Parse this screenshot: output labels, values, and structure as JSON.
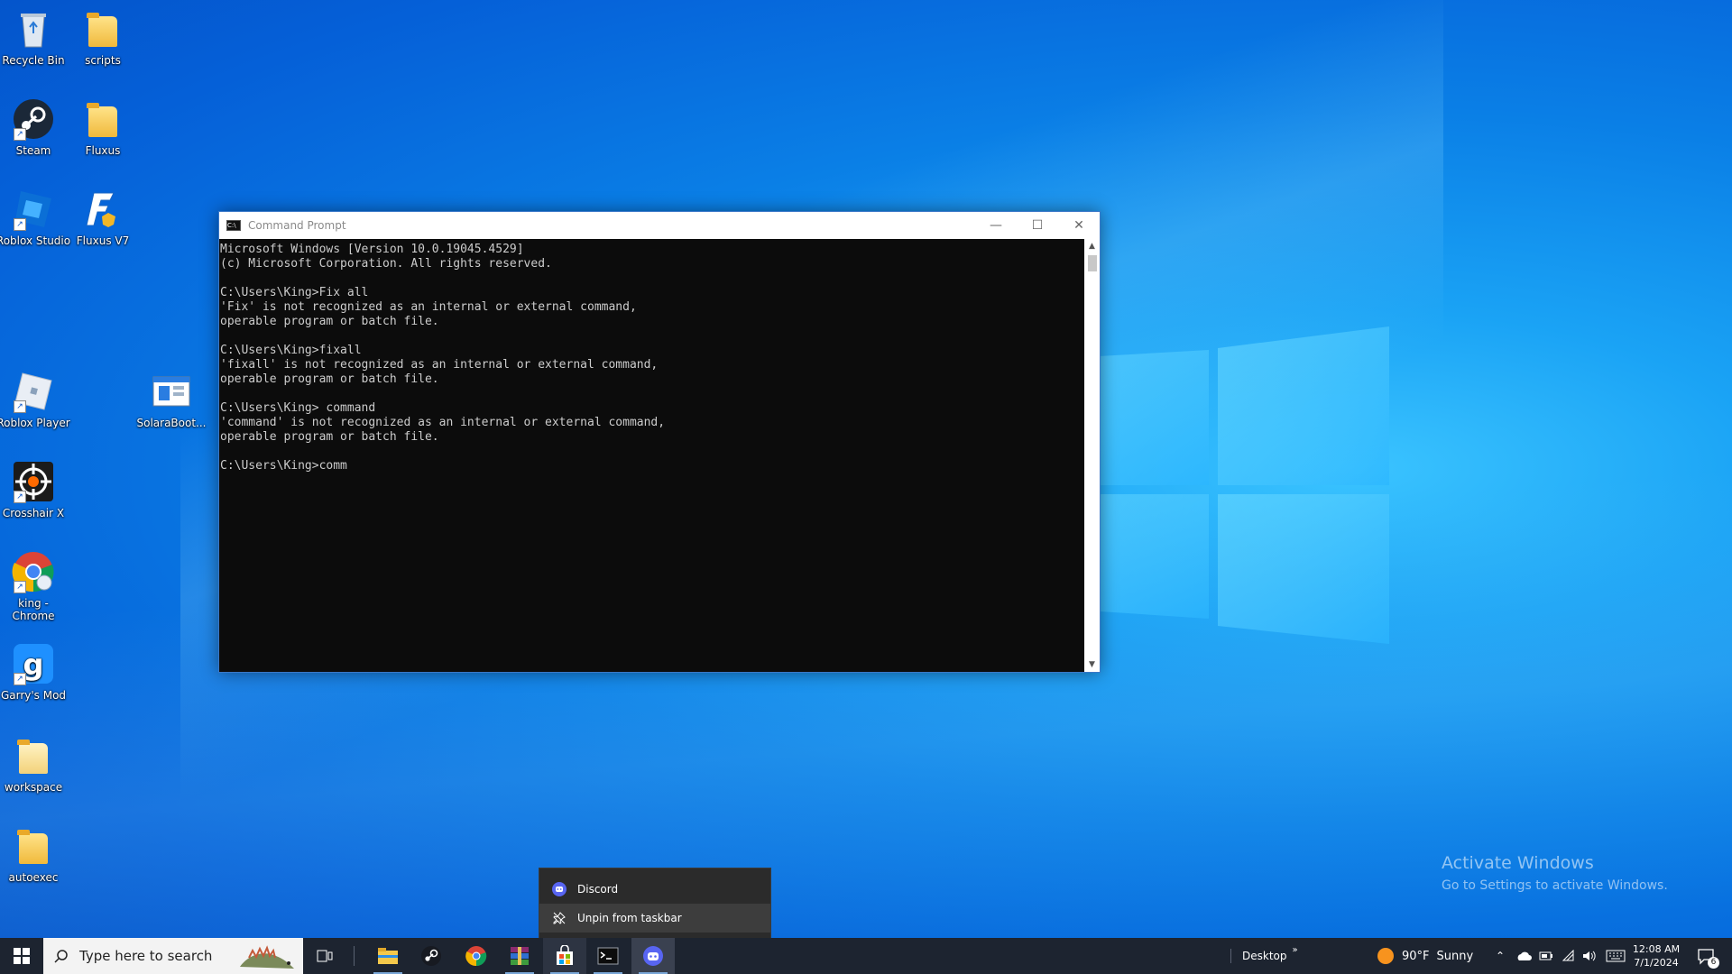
{
  "desktop_icons": [
    {
      "label": "Recycle Bin"
    },
    {
      "label": "scripts"
    },
    {
      "label": "Steam"
    },
    {
      "label": "Fluxus"
    },
    {
      "label": "Roblox Studio"
    },
    {
      "label": "Fluxus V7"
    },
    {
      "label": "Roblox Player"
    },
    {
      "label": "SolaraBoot..."
    },
    {
      "label": "Crosshair X"
    },
    {
      "label": "king - Chrome"
    },
    {
      "label": "Garry's Mod"
    },
    {
      "label": "workspace"
    },
    {
      "label": "autoexec"
    }
  ],
  "cmd": {
    "title": "Command Prompt",
    "output": "Microsoft Windows [Version 10.0.19045.4529]\n(c) Microsoft Corporation. All rights reserved.\n\nC:\\Users\\King>Fix all\n'Fix' is not recognized as an internal or external command,\noperable program or batch file.\n\nC:\\Users\\King>fixall\n'fixall' is not recognized as an internal or external command,\noperable program or batch file.\n\nC:\\Users\\King> command\n'command' is not recognized as an internal or external command,\noperable program or batch file.\n\nC:\\Users\\King>comm"
  },
  "jump_list": {
    "app_label": "Discord",
    "unpin_label": "Unpin from taskbar"
  },
  "watermark": {
    "line1": "Activate Windows",
    "line2": "Go to Settings to activate Windows."
  },
  "taskbar": {
    "search_placeholder": "Type here to search",
    "desktop_label": "Desktop",
    "weather_temp": "90°F",
    "weather_cond": "Sunny",
    "time": "12:08 AM",
    "date": "7/1/2024",
    "notification_count": "6",
    "apps": [
      "file-explorer",
      "steam",
      "chrome",
      "winrar",
      "microsoft-store",
      "command-prompt",
      "discord"
    ]
  },
  "colors": {
    "taskbar_bg": "#1d2430",
    "discord": "#5865f2",
    "cmd_bg": "#0c0c0c"
  }
}
